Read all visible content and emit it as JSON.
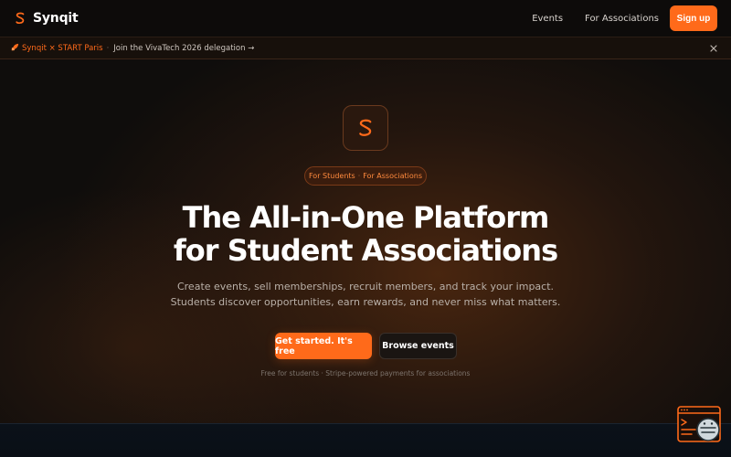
{
  "nav": {
    "brand": "Synqit",
    "links": [
      "Events",
      "For Associations"
    ],
    "signup": "Sign up"
  },
  "announcement": {
    "icon": "rocket-icon",
    "brand": "Synqit × START Paris",
    "separator": "·",
    "link": "Join the VivaTech 2026 delegation →",
    "close_icon": "close-icon"
  },
  "hero": {
    "pill": {
      "left": "For Students",
      "separator": "·",
      "right": "For Associations"
    },
    "headline_line1": "The All-in-One Platform",
    "headline_line2": "for Student Associations",
    "subtext": "Create events, sell memberships, recruit members, and track your impact. Students discover opportunities, earn rewards, and never miss what matters.",
    "cta_primary": "Get started. It's free",
    "cta_secondary": "Browse events",
    "footnote": "Free for students · Stripe-powered payments for associations"
  },
  "colors": {
    "accent": "#ff6a1a",
    "background": "#0f0d0c"
  }
}
